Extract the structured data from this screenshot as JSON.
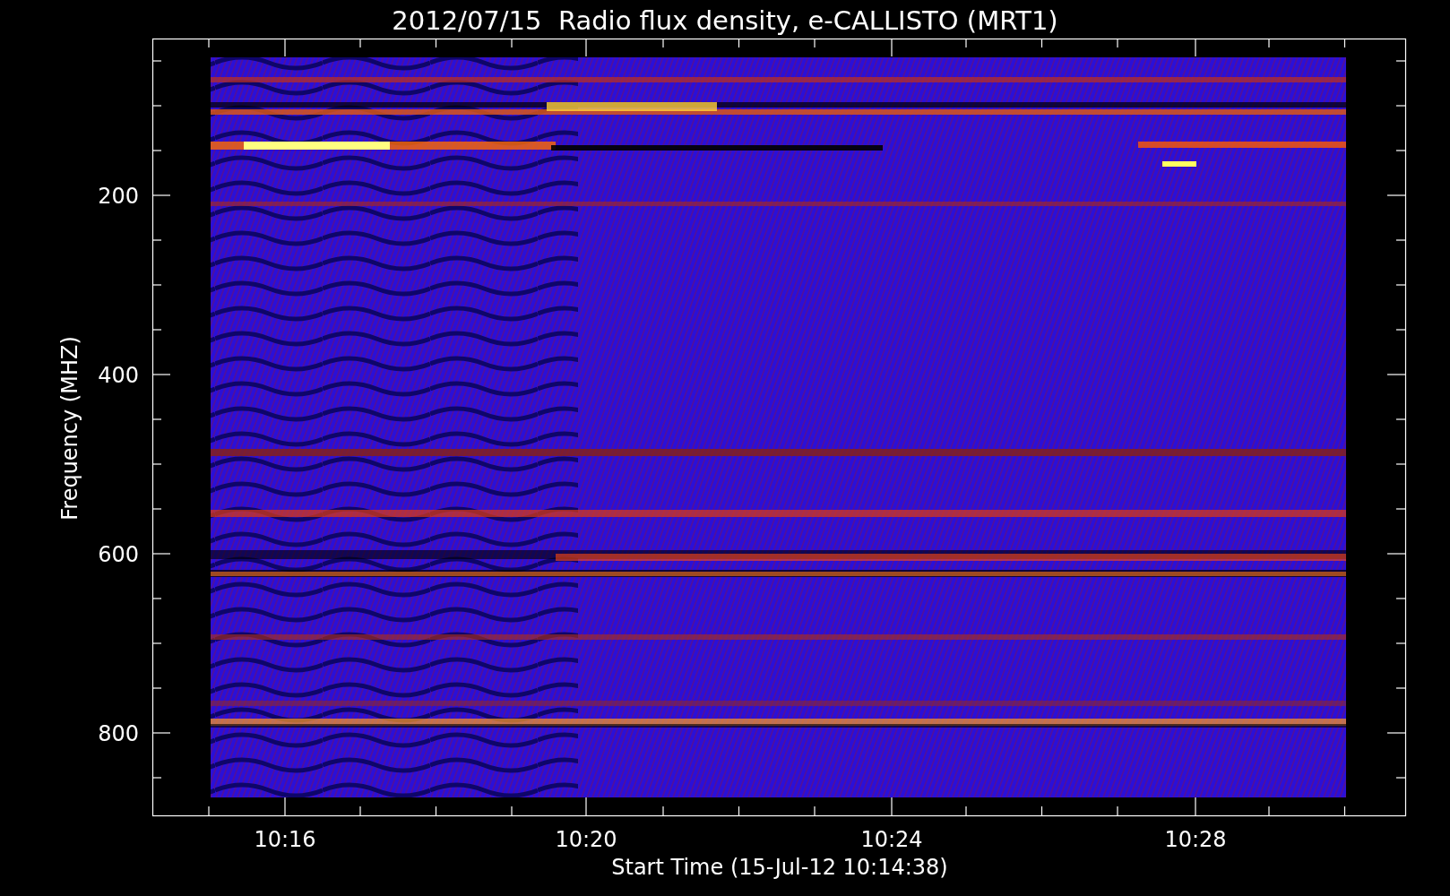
{
  "title": "2012/07/15  Radio flux density, e-CALLISTO (MRT1)",
  "xlabel": "Start Time (15-Jul-12 10:14:38)",
  "ylabel": "Frequency (MHZ)",
  "yticks": [
    "200",
    "400",
    "600",
    "800"
  ],
  "xticks": [
    "10:16",
    "10:20",
    "10:24",
    "10:28"
  ]
}
